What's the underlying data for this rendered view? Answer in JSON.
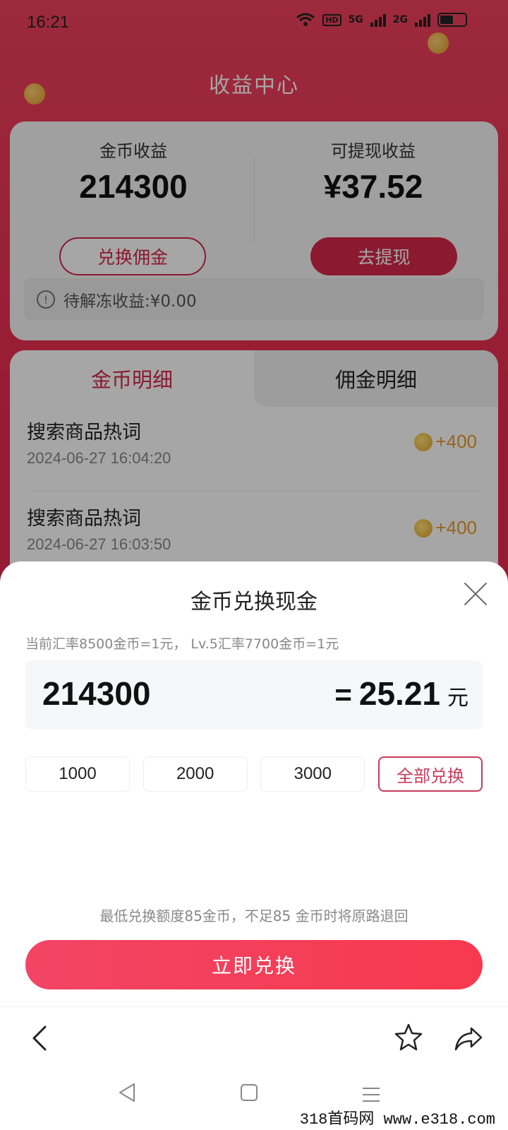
{
  "status_bar": {
    "time": "16:21",
    "net1": "5G",
    "net2": "2G",
    "hd": "HD"
  },
  "header": {
    "title": "收益中心"
  },
  "earnings": {
    "coin_label": "金币收益",
    "coin_value": "214300",
    "coin_button": "兑换佣金",
    "cash_label": "可提现收益",
    "cash_value": "¥37.52",
    "cash_button": "去提现",
    "frozen": "待解冻收益:¥0.00"
  },
  "detail": {
    "tabs": [
      {
        "label": "金币明细",
        "active": true
      },
      {
        "label": "佣金明细",
        "active": false
      }
    ],
    "records": [
      {
        "title": "搜索商品热词",
        "time": "2024-06-27 16:04:20",
        "amount": "+400"
      },
      {
        "title": "搜索商品热词",
        "time": "2024-06-27 16:03:50",
        "amount": "+400"
      }
    ]
  },
  "sheet": {
    "title": "金币兑换现金",
    "rate": "当前汇率8500金币=1元， Lv.5汇率7700金币=1元",
    "coin_amount": "214300",
    "equals": "=",
    "cash_amount": "25.21",
    "cash_unit": "元",
    "presets": [
      "1000",
      "2000",
      "3000",
      "全部兑换"
    ],
    "min_tip": "最低兑换额度85金币，不足85 金币时将原路退回",
    "exchange_button": "立即兑换"
  },
  "watermark": "318首码网 www.e318.com",
  "colors": {
    "accent": "#d5294b",
    "coin": "#e89a2a",
    "button": "#f24565"
  }
}
